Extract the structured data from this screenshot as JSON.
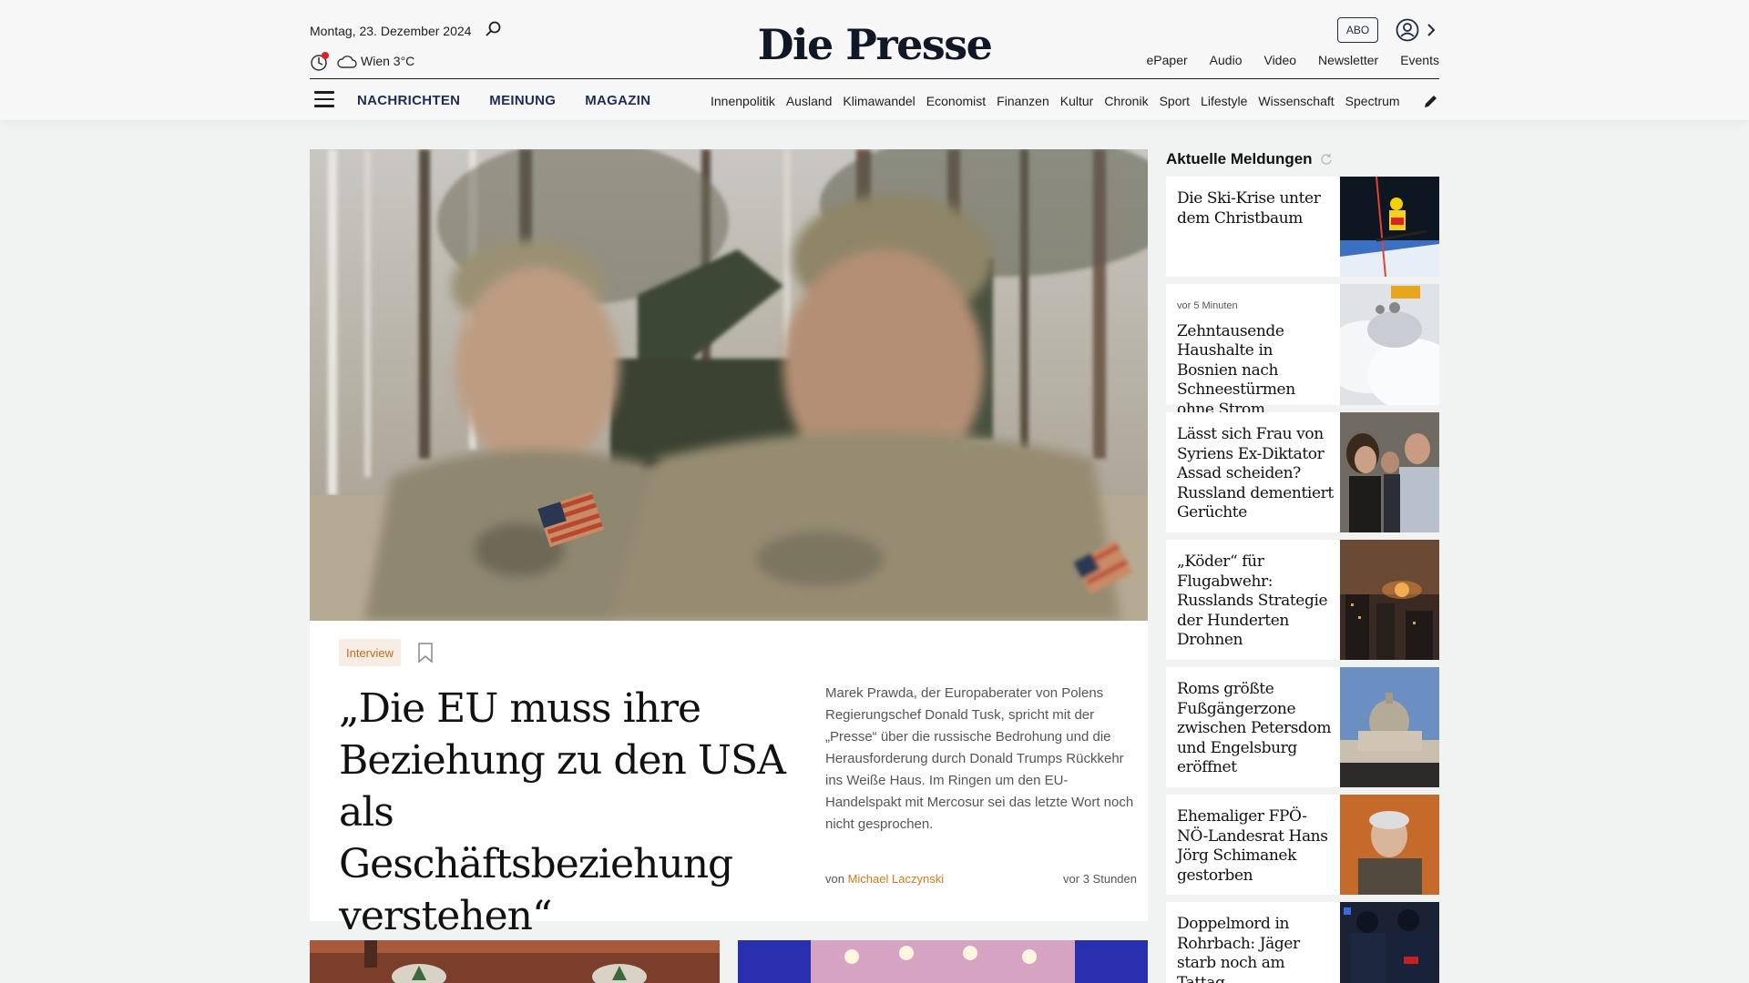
{
  "header": {
    "date": "Montag, 23. Dezember 2024",
    "weather": "Wien 3°C",
    "logo": "Die Presse",
    "abo_label": "ABO",
    "topnav": [
      "ePaper",
      "Audio",
      "Video",
      "Newsletter",
      "Events"
    ],
    "mainnav": [
      "NACHRICHTEN",
      "MEINUNG",
      "MAGAZIN"
    ],
    "subnav": [
      "Innenpolitik",
      "Ausland",
      "Klimawandel",
      "Economist",
      "Finanzen",
      "Kultur",
      "Chronik",
      "Sport",
      "Lifestyle",
      "Wissenschaft",
      "Spectrum"
    ]
  },
  "hero": {
    "tag": "Interview",
    "headline": "„Die EU muss ihre Beziehung zu den USA als Geschäftsbeziehung verstehen“",
    "teaser": "Marek Prawda, der Europaberater von Polens Regierungschef Donald Tusk, spricht mit der „Presse“ über die russische Bedrohung und die Herausforderung durch Donald Trumps Rückkehr ins Weiße Haus. Im Ringen um den EU-Handelspakt mit Mercosur sei das letzte Wort noch nicht gesprochen.",
    "byline_prefix": "von",
    "author": "Michael Laczynski",
    "time": "vor 3 Stunden"
  },
  "sidebar": {
    "title": "Aktuelle Meldungen",
    "items": [
      {
        "meta": "",
        "title": "Die Ski-Krise unter dem Christbaum"
      },
      {
        "meta": "vor 5 Minuten",
        "title": "Zehntausende Haushalte in Bosnien nach Schneestürmen ohne Strom"
      },
      {
        "meta": "",
        "title": "Lässt sich Frau von Syriens Ex-Diktator Assad scheiden? Russland dementiert Gerüchte"
      },
      {
        "meta": "",
        "title": "„Köder“ für Flugabwehr: Russlands Strategie der Hunderten Drohnen"
      },
      {
        "meta": "",
        "title": "Roms größte Fußgängerzone zwischen Petersdom und Engelsburg eröffnet"
      },
      {
        "meta": "",
        "title": "Ehemaliger FPÖ-NÖ-Landesrat Hans Jörg Schimanek gestorben"
      },
      {
        "meta": "",
        "title": "Doppelmord in Rohrbach: Jäger starb noch am Tattag"
      }
    ]
  },
  "colors": {
    "brand_navy": "#1e2d58",
    "accent_orange": "#d07a1a",
    "live_red": "#e02020"
  }
}
